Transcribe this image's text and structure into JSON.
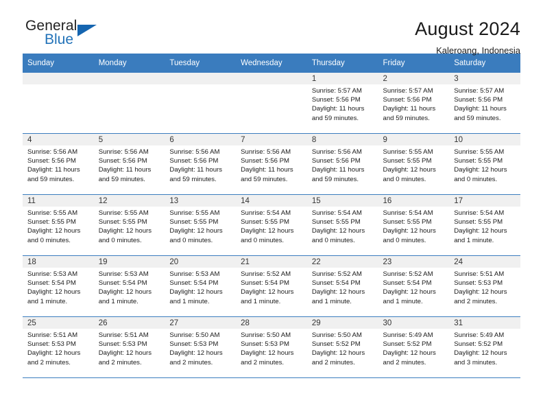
{
  "brand": {
    "line1": "General",
    "line2": "Blue",
    "triangle_icon": "triangle-icon",
    "color_text": "#222222",
    "color_blue": "#2272b8"
  },
  "header": {
    "title": "August 2024",
    "subtitle": "Kaleroang, Indonesia"
  },
  "theme": {
    "header_bg": "#3a7cbe",
    "header_text": "#ffffff",
    "daynum_bg": "#f0f0f0",
    "grid_line": "#3a7cbe"
  },
  "weekday_headers": [
    "Sunday",
    "Monday",
    "Tuesday",
    "Wednesday",
    "Thursday",
    "Friday",
    "Saturday"
  ],
  "weeks": [
    [
      {
        "day": "",
        "blank": true,
        "sunrise": "",
        "sunset": "",
        "daylight1": "",
        "daylight2": ""
      },
      {
        "day": "",
        "blank": true,
        "sunrise": "",
        "sunset": "",
        "daylight1": "",
        "daylight2": ""
      },
      {
        "day": "",
        "blank": true,
        "sunrise": "",
        "sunset": "",
        "daylight1": "",
        "daylight2": ""
      },
      {
        "day": "",
        "blank": true,
        "sunrise": "",
        "sunset": "",
        "daylight1": "",
        "daylight2": ""
      },
      {
        "day": "1",
        "blank": false,
        "sunrise": "Sunrise: 5:57 AM",
        "sunset": "Sunset: 5:56 PM",
        "daylight1": "Daylight: 11 hours",
        "daylight2": "and 59 minutes."
      },
      {
        "day": "2",
        "blank": false,
        "sunrise": "Sunrise: 5:57 AM",
        "sunset": "Sunset: 5:56 PM",
        "daylight1": "Daylight: 11 hours",
        "daylight2": "and 59 minutes."
      },
      {
        "day": "3",
        "blank": false,
        "sunrise": "Sunrise: 5:57 AM",
        "sunset": "Sunset: 5:56 PM",
        "daylight1": "Daylight: 11 hours",
        "daylight2": "and 59 minutes."
      }
    ],
    [
      {
        "day": "4",
        "blank": false,
        "sunrise": "Sunrise: 5:56 AM",
        "sunset": "Sunset: 5:56 PM",
        "daylight1": "Daylight: 11 hours",
        "daylight2": "and 59 minutes."
      },
      {
        "day": "5",
        "blank": false,
        "sunrise": "Sunrise: 5:56 AM",
        "sunset": "Sunset: 5:56 PM",
        "daylight1": "Daylight: 11 hours",
        "daylight2": "and 59 minutes."
      },
      {
        "day": "6",
        "blank": false,
        "sunrise": "Sunrise: 5:56 AM",
        "sunset": "Sunset: 5:56 PM",
        "daylight1": "Daylight: 11 hours",
        "daylight2": "and 59 minutes."
      },
      {
        "day": "7",
        "blank": false,
        "sunrise": "Sunrise: 5:56 AM",
        "sunset": "Sunset: 5:56 PM",
        "daylight1": "Daylight: 11 hours",
        "daylight2": "and 59 minutes."
      },
      {
        "day": "8",
        "blank": false,
        "sunrise": "Sunrise: 5:56 AM",
        "sunset": "Sunset: 5:56 PM",
        "daylight1": "Daylight: 11 hours",
        "daylight2": "and 59 minutes."
      },
      {
        "day": "9",
        "blank": false,
        "sunrise": "Sunrise: 5:55 AM",
        "sunset": "Sunset: 5:55 PM",
        "daylight1": "Daylight: 12 hours",
        "daylight2": "and 0 minutes."
      },
      {
        "day": "10",
        "blank": false,
        "sunrise": "Sunrise: 5:55 AM",
        "sunset": "Sunset: 5:55 PM",
        "daylight1": "Daylight: 12 hours",
        "daylight2": "and 0 minutes."
      }
    ],
    [
      {
        "day": "11",
        "blank": false,
        "sunrise": "Sunrise: 5:55 AM",
        "sunset": "Sunset: 5:55 PM",
        "daylight1": "Daylight: 12 hours",
        "daylight2": "and 0 minutes."
      },
      {
        "day": "12",
        "blank": false,
        "sunrise": "Sunrise: 5:55 AM",
        "sunset": "Sunset: 5:55 PM",
        "daylight1": "Daylight: 12 hours",
        "daylight2": "and 0 minutes."
      },
      {
        "day": "13",
        "blank": false,
        "sunrise": "Sunrise: 5:55 AM",
        "sunset": "Sunset: 5:55 PM",
        "daylight1": "Daylight: 12 hours",
        "daylight2": "and 0 minutes."
      },
      {
        "day": "14",
        "blank": false,
        "sunrise": "Sunrise: 5:54 AM",
        "sunset": "Sunset: 5:55 PM",
        "daylight1": "Daylight: 12 hours",
        "daylight2": "and 0 minutes."
      },
      {
        "day": "15",
        "blank": false,
        "sunrise": "Sunrise: 5:54 AM",
        "sunset": "Sunset: 5:55 PM",
        "daylight1": "Daylight: 12 hours",
        "daylight2": "and 0 minutes."
      },
      {
        "day": "16",
        "blank": false,
        "sunrise": "Sunrise: 5:54 AM",
        "sunset": "Sunset: 5:55 PM",
        "daylight1": "Daylight: 12 hours",
        "daylight2": "and 0 minutes."
      },
      {
        "day": "17",
        "blank": false,
        "sunrise": "Sunrise: 5:54 AM",
        "sunset": "Sunset: 5:55 PM",
        "daylight1": "Daylight: 12 hours",
        "daylight2": "and 1 minute."
      }
    ],
    [
      {
        "day": "18",
        "blank": false,
        "sunrise": "Sunrise: 5:53 AM",
        "sunset": "Sunset: 5:54 PM",
        "daylight1": "Daylight: 12 hours",
        "daylight2": "and 1 minute."
      },
      {
        "day": "19",
        "blank": false,
        "sunrise": "Sunrise: 5:53 AM",
        "sunset": "Sunset: 5:54 PM",
        "daylight1": "Daylight: 12 hours",
        "daylight2": "and 1 minute."
      },
      {
        "day": "20",
        "blank": false,
        "sunrise": "Sunrise: 5:53 AM",
        "sunset": "Sunset: 5:54 PM",
        "daylight1": "Daylight: 12 hours",
        "daylight2": "and 1 minute."
      },
      {
        "day": "21",
        "blank": false,
        "sunrise": "Sunrise: 5:52 AM",
        "sunset": "Sunset: 5:54 PM",
        "daylight1": "Daylight: 12 hours",
        "daylight2": "and 1 minute."
      },
      {
        "day": "22",
        "blank": false,
        "sunrise": "Sunrise: 5:52 AM",
        "sunset": "Sunset: 5:54 PM",
        "daylight1": "Daylight: 12 hours",
        "daylight2": "and 1 minute."
      },
      {
        "day": "23",
        "blank": false,
        "sunrise": "Sunrise: 5:52 AM",
        "sunset": "Sunset: 5:54 PM",
        "daylight1": "Daylight: 12 hours",
        "daylight2": "and 1 minute."
      },
      {
        "day": "24",
        "blank": false,
        "sunrise": "Sunrise: 5:51 AM",
        "sunset": "Sunset: 5:53 PM",
        "daylight1": "Daylight: 12 hours",
        "daylight2": "and 2 minutes."
      }
    ],
    [
      {
        "day": "25",
        "blank": false,
        "sunrise": "Sunrise: 5:51 AM",
        "sunset": "Sunset: 5:53 PM",
        "daylight1": "Daylight: 12 hours",
        "daylight2": "and 2 minutes."
      },
      {
        "day": "26",
        "blank": false,
        "sunrise": "Sunrise: 5:51 AM",
        "sunset": "Sunset: 5:53 PM",
        "daylight1": "Daylight: 12 hours",
        "daylight2": "and 2 minutes."
      },
      {
        "day": "27",
        "blank": false,
        "sunrise": "Sunrise: 5:50 AM",
        "sunset": "Sunset: 5:53 PM",
        "daylight1": "Daylight: 12 hours",
        "daylight2": "and 2 minutes."
      },
      {
        "day": "28",
        "blank": false,
        "sunrise": "Sunrise: 5:50 AM",
        "sunset": "Sunset: 5:53 PM",
        "daylight1": "Daylight: 12 hours",
        "daylight2": "and 2 minutes."
      },
      {
        "day": "29",
        "blank": false,
        "sunrise": "Sunrise: 5:50 AM",
        "sunset": "Sunset: 5:52 PM",
        "daylight1": "Daylight: 12 hours",
        "daylight2": "and 2 minutes."
      },
      {
        "day": "30",
        "blank": false,
        "sunrise": "Sunrise: 5:49 AM",
        "sunset": "Sunset: 5:52 PM",
        "daylight1": "Daylight: 12 hours",
        "daylight2": "and 2 minutes."
      },
      {
        "day": "31",
        "blank": false,
        "sunrise": "Sunrise: 5:49 AM",
        "sunset": "Sunset: 5:52 PM",
        "daylight1": "Daylight: 12 hours",
        "daylight2": "and 3 minutes."
      }
    ]
  ]
}
